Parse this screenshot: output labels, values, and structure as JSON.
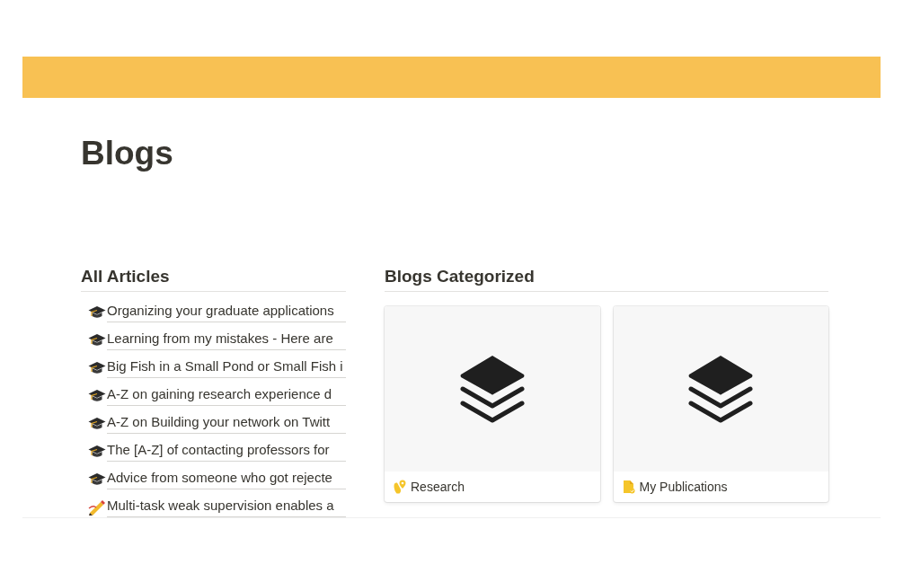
{
  "page": {
    "title": "Blogs"
  },
  "all_articles": {
    "heading": "All Articles",
    "items": [
      {
        "kind": "cap",
        "title": "Organizing your graduate applications"
      },
      {
        "kind": "cap",
        "title": "Learning from my mistakes - Here are"
      },
      {
        "kind": "cap",
        "title": "Big Fish in a Small Pond or Small Fish i"
      },
      {
        "kind": "cap",
        "title": "A-Z on gaining research experience d"
      },
      {
        "kind": "cap",
        "title": "A-Z on Building your network on Twitt"
      },
      {
        "kind": "cap",
        "title": "The [A-Z] of contacting professors for"
      },
      {
        "kind": "cap",
        "title": "Advice from someone who got rejecte"
      },
      {
        "kind": "pencil",
        "title": "Multi-task weak supervision enables a"
      }
    ]
  },
  "blogs_categorized": {
    "heading": "Blogs Categorized",
    "cards": [
      {
        "kind": "pin",
        "title": "Research"
      },
      {
        "kind": "document",
        "title": "My Publications"
      }
    ]
  }
}
